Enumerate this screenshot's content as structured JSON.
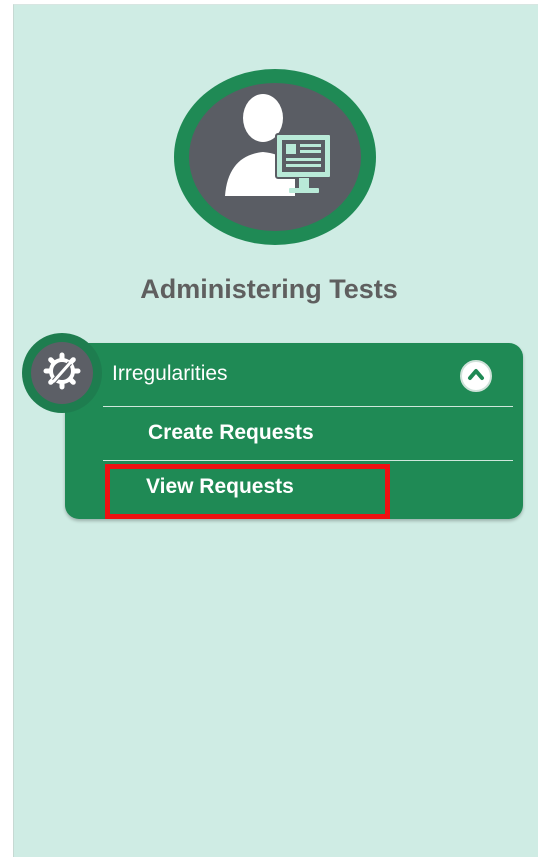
{
  "section": {
    "title": "Administering Tests"
  },
  "menu": {
    "header_label": "Irregularities",
    "items": [
      {
        "label": "Create Requests"
      },
      {
        "label": "View Requests"
      }
    ]
  },
  "icons": {
    "avatar": "user-monitor-icon",
    "badge": "gear-wrench-icon",
    "toggle": "chevron-up-icon"
  },
  "colors": {
    "panel_bg": "#cfece4",
    "menu_green": "#1f8a55",
    "highlight_red": "#ee1111"
  }
}
